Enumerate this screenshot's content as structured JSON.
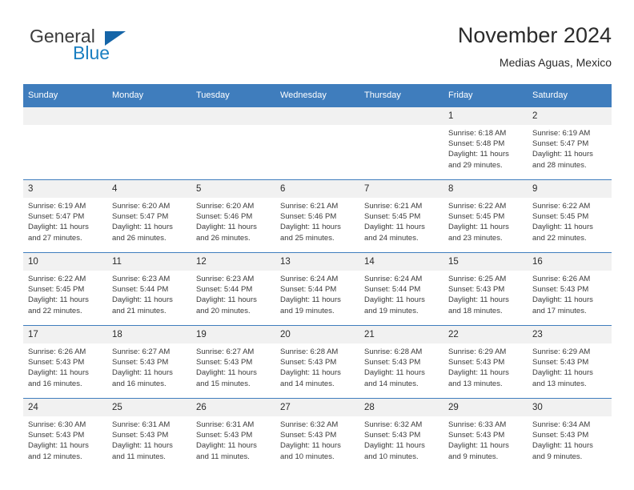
{
  "logo": {
    "text_primary": "General",
    "text_secondary": "Blue",
    "icon": "triangle-flag-icon",
    "color_primary": "#3c3c3c",
    "color_secondary": "#1a7fc1",
    "color_triangle": "#1565a8"
  },
  "header": {
    "title": "November 2024",
    "subtitle": "Medias Aguas, Mexico",
    "accent_color": "#3f7dbd"
  },
  "calendar": {
    "weekday_headers": [
      "Sunday",
      "Monday",
      "Tuesday",
      "Wednesday",
      "Thursday",
      "Friday",
      "Saturday"
    ],
    "weeks": [
      [
        {
          "day": "",
          "sunrise": "",
          "sunset": "",
          "daylight_line1": "",
          "daylight_line2": ""
        },
        {
          "day": "",
          "sunrise": "",
          "sunset": "",
          "daylight_line1": "",
          "daylight_line2": ""
        },
        {
          "day": "",
          "sunrise": "",
          "sunset": "",
          "daylight_line1": "",
          "daylight_line2": ""
        },
        {
          "day": "",
          "sunrise": "",
          "sunset": "",
          "daylight_line1": "",
          "daylight_line2": ""
        },
        {
          "day": "",
          "sunrise": "",
          "sunset": "",
          "daylight_line1": "",
          "daylight_line2": ""
        },
        {
          "day": "1",
          "sunrise": "Sunrise: 6:18 AM",
          "sunset": "Sunset: 5:48 PM",
          "daylight_line1": "Daylight: 11 hours",
          "daylight_line2": "and 29 minutes."
        },
        {
          "day": "2",
          "sunrise": "Sunrise: 6:19 AM",
          "sunset": "Sunset: 5:47 PM",
          "daylight_line1": "Daylight: 11 hours",
          "daylight_line2": "and 28 minutes."
        }
      ],
      [
        {
          "day": "3",
          "sunrise": "Sunrise: 6:19 AM",
          "sunset": "Sunset: 5:47 PM",
          "daylight_line1": "Daylight: 11 hours",
          "daylight_line2": "and 27 minutes."
        },
        {
          "day": "4",
          "sunrise": "Sunrise: 6:20 AM",
          "sunset": "Sunset: 5:47 PM",
          "daylight_line1": "Daylight: 11 hours",
          "daylight_line2": "and 26 minutes."
        },
        {
          "day": "5",
          "sunrise": "Sunrise: 6:20 AM",
          "sunset": "Sunset: 5:46 PM",
          "daylight_line1": "Daylight: 11 hours",
          "daylight_line2": "and 26 minutes."
        },
        {
          "day": "6",
          "sunrise": "Sunrise: 6:21 AM",
          "sunset": "Sunset: 5:46 PM",
          "daylight_line1": "Daylight: 11 hours",
          "daylight_line2": "and 25 minutes."
        },
        {
          "day": "7",
          "sunrise": "Sunrise: 6:21 AM",
          "sunset": "Sunset: 5:45 PM",
          "daylight_line1": "Daylight: 11 hours",
          "daylight_line2": "and 24 minutes."
        },
        {
          "day": "8",
          "sunrise": "Sunrise: 6:22 AM",
          "sunset": "Sunset: 5:45 PM",
          "daylight_line1": "Daylight: 11 hours",
          "daylight_line2": "and 23 minutes."
        },
        {
          "day": "9",
          "sunrise": "Sunrise: 6:22 AM",
          "sunset": "Sunset: 5:45 PM",
          "daylight_line1": "Daylight: 11 hours",
          "daylight_line2": "and 22 minutes."
        }
      ],
      [
        {
          "day": "10",
          "sunrise": "Sunrise: 6:22 AM",
          "sunset": "Sunset: 5:45 PM",
          "daylight_line1": "Daylight: 11 hours",
          "daylight_line2": "and 22 minutes."
        },
        {
          "day": "11",
          "sunrise": "Sunrise: 6:23 AM",
          "sunset": "Sunset: 5:44 PM",
          "daylight_line1": "Daylight: 11 hours",
          "daylight_line2": "and 21 minutes."
        },
        {
          "day": "12",
          "sunrise": "Sunrise: 6:23 AM",
          "sunset": "Sunset: 5:44 PM",
          "daylight_line1": "Daylight: 11 hours",
          "daylight_line2": "and 20 minutes."
        },
        {
          "day": "13",
          "sunrise": "Sunrise: 6:24 AM",
          "sunset": "Sunset: 5:44 PM",
          "daylight_line1": "Daylight: 11 hours",
          "daylight_line2": "and 19 minutes."
        },
        {
          "day": "14",
          "sunrise": "Sunrise: 6:24 AM",
          "sunset": "Sunset: 5:44 PM",
          "daylight_line1": "Daylight: 11 hours",
          "daylight_line2": "and 19 minutes."
        },
        {
          "day": "15",
          "sunrise": "Sunrise: 6:25 AM",
          "sunset": "Sunset: 5:43 PM",
          "daylight_line1": "Daylight: 11 hours",
          "daylight_line2": "and 18 minutes."
        },
        {
          "day": "16",
          "sunrise": "Sunrise: 6:26 AM",
          "sunset": "Sunset: 5:43 PM",
          "daylight_line1": "Daylight: 11 hours",
          "daylight_line2": "and 17 minutes."
        }
      ],
      [
        {
          "day": "17",
          "sunrise": "Sunrise: 6:26 AM",
          "sunset": "Sunset: 5:43 PM",
          "daylight_line1": "Daylight: 11 hours",
          "daylight_line2": "and 16 minutes."
        },
        {
          "day": "18",
          "sunrise": "Sunrise: 6:27 AM",
          "sunset": "Sunset: 5:43 PM",
          "daylight_line1": "Daylight: 11 hours",
          "daylight_line2": "and 16 minutes."
        },
        {
          "day": "19",
          "sunrise": "Sunrise: 6:27 AM",
          "sunset": "Sunset: 5:43 PM",
          "daylight_line1": "Daylight: 11 hours",
          "daylight_line2": "and 15 minutes."
        },
        {
          "day": "20",
          "sunrise": "Sunrise: 6:28 AM",
          "sunset": "Sunset: 5:43 PM",
          "daylight_line1": "Daylight: 11 hours",
          "daylight_line2": "and 14 minutes."
        },
        {
          "day": "21",
          "sunrise": "Sunrise: 6:28 AM",
          "sunset": "Sunset: 5:43 PM",
          "daylight_line1": "Daylight: 11 hours",
          "daylight_line2": "and 14 minutes."
        },
        {
          "day": "22",
          "sunrise": "Sunrise: 6:29 AM",
          "sunset": "Sunset: 5:43 PM",
          "daylight_line1": "Daylight: 11 hours",
          "daylight_line2": "and 13 minutes."
        },
        {
          "day": "23",
          "sunrise": "Sunrise: 6:29 AM",
          "sunset": "Sunset: 5:43 PM",
          "daylight_line1": "Daylight: 11 hours",
          "daylight_line2": "and 13 minutes."
        }
      ],
      [
        {
          "day": "24",
          "sunrise": "Sunrise: 6:30 AM",
          "sunset": "Sunset: 5:43 PM",
          "daylight_line1": "Daylight: 11 hours",
          "daylight_line2": "and 12 minutes."
        },
        {
          "day": "25",
          "sunrise": "Sunrise: 6:31 AM",
          "sunset": "Sunset: 5:43 PM",
          "daylight_line1": "Daylight: 11 hours",
          "daylight_line2": "and 11 minutes."
        },
        {
          "day": "26",
          "sunrise": "Sunrise: 6:31 AM",
          "sunset": "Sunset: 5:43 PM",
          "daylight_line1": "Daylight: 11 hours",
          "daylight_line2": "and 11 minutes."
        },
        {
          "day": "27",
          "sunrise": "Sunrise: 6:32 AM",
          "sunset": "Sunset: 5:43 PM",
          "daylight_line1": "Daylight: 11 hours",
          "daylight_line2": "and 10 minutes."
        },
        {
          "day": "28",
          "sunrise": "Sunrise: 6:32 AM",
          "sunset": "Sunset: 5:43 PM",
          "daylight_line1": "Daylight: 11 hours",
          "daylight_line2": "and 10 minutes."
        },
        {
          "day": "29",
          "sunrise": "Sunrise: 6:33 AM",
          "sunset": "Sunset: 5:43 PM",
          "daylight_line1": "Daylight: 11 hours",
          "daylight_line2": "and 9 minutes."
        },
        {
          "day": "30",
          "sunrise": "Sunrise: 6:34 AM",
          "sunset": "Sunset: 5:43 PM",
          "daylight_line1": "Daylight: 11 hours",
          "daylight_line2": "and 9 minutes."
        }
      ]
    ]
  }
}
